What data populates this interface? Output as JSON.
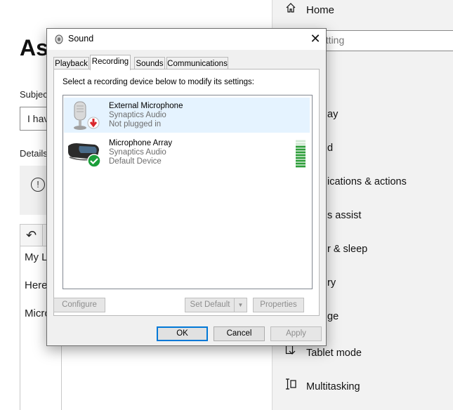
{
  "background_app": {
    "heading": "As",
    "subject_label": "Subjec",
    "subject_value": "I hav",
    "details_label": "Details",
    "body_lines": [
      "My L",
      "Here",
      "Micro"
    ]
  },
  "settings": {
    "home_label": "Home",
    "search_placeholder": "etting",
    "items": [
      {
        "label": "ay",
        "icon": "display-icon"
      },
      {
        "label": "d",
        "icon": "sound-icon"
      },
      {
        "label": "ications & actions",
        "icon": "notifications-icon"
      },
      {
        "label": "s assist",
        "icon": "focus-assist-icon"
      },
      {
        "label": "r & sleep",
        "icon": "power-icon"
      },
      {
        "label": "ry",
        "icon": "battery-icon"
      },
      {
        "label": "ge",
        "icon": "storage-icon"
      },
      {
        "label": "Tablet mode",
        "icon": "tablet-mode-icon"
      },
      {
        "label": "Multitasking",
        "icon": "multitasking-icon"
      }
    ]
  },
  "dialog": {
    "title": "Sound",
    "tabs": [
      {
        "label": "Playback",
        "active": false
      },
      {
        "label": "Recording",
        "active": true
      },
      {
        "label": "Sounds",
        "active": false
      },
      {
        "label": "Communications",
        "active": false
      }
    ],
    "instruction": "Select a recording device below to modify its settings:",
    "devices": [
      {
        "name": "External Microphone",
        "driver": "Synaptics Audio",
        "status": "Not plugged in",
        "selected": true,
        "status_icon": "unplugged-arrow-icon",
        "status_color": "#d9262b"
      },
      {
        "name": "Microphone Array",
        "driver": "Synaptics Audio",
        "status": "Default Device",
        "selected": false,
        "status_icon": "default-check-icon",
        "status_color": "#1b9e3a",
        "level_meter_bars": 10,
        "level_meter_active": 8
      }
    ],
    "buttons": {
      "configure": "Configure",
      "set_default": "Set Default",
      "properties": "Properties",
      "ok": "OK",
      "cancel": "Cancel",
      "apply": "Apply"
    }
  },
  "colors": {
    "accent": "#0078d7",
    "selection": "#e5f3ff",
    "level_meter": "#2e9e3a"
  }
}
